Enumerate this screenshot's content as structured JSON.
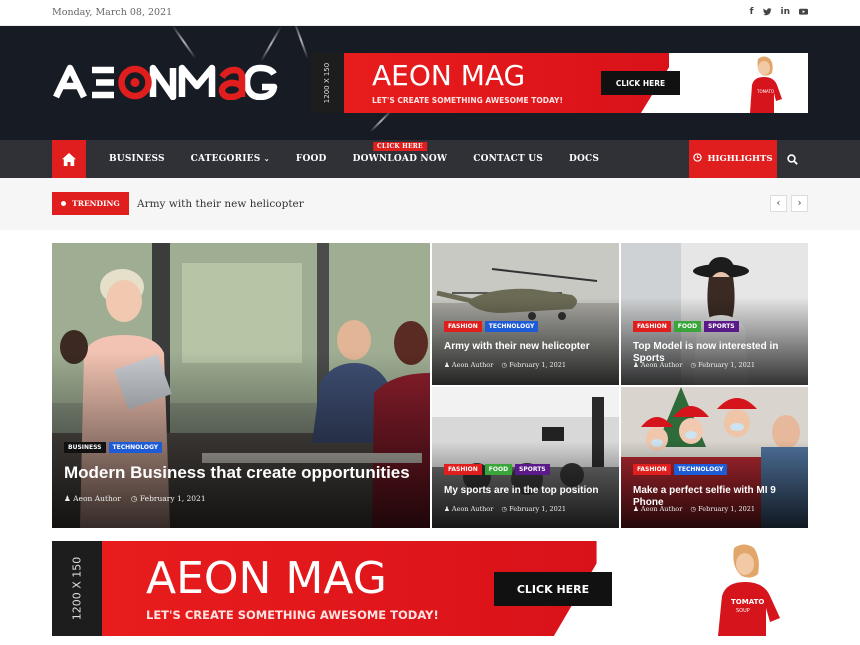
{
  "topbar": {
    "date": "Monday, March 08, 2021",
    "social": [
      "f",
      "t",
      "in",
      "yt"
    ]
  },
  "header": {
    "logo_text": "AEONMAG",
    "banner": {
      "size_label": "1200 X 150",
      "title": "AEON MAG",
      "tagline": "LET'S CREATE SOMETHING AWESOME TODAY!",
      "cta": "CLICK HERE"
    }
  },
  "nav": {
    "items": [
      "BUSINESS",
      "CATEGORIES",
      "FOOD",
      "DOWNLOAD NOW",
      "CONTACT US",
      "DOCS"
    ],
    "badge": "CLICK HERE",
    "highlights": "HIGHLIGHTS"
  },
  "trending": {
    "label": "TRENDING",
    "text": "Army with their new helicopter"
  },
  "posts": [
    {
      "cats": [
        "BUSINESS",
        "TECHNOLOGY"
      ],
      "title": "Modern Business that create opportunities",
      "author": "Aeon Author",
      "date": "February 1, 2021"
    },
    {
      "cats": [
        "FASHION",
        "TECHNOLOGY"
      ],
      "title": "Army with their new helicopter",
      "author": "Aeon Author",
      "date": "February 1, 2021"
    },
    {
      "cats": [
        "FASHION",
        "FOOD",
        "SPORTS"
      ],
      "title": "Top Model is now interested in Sports",
      "author": "Aeon Author",
      "date": "February 1, 2021"
    },
    {
      "cats": [
        "FASHION",
        "FOOD",
        "SPORTS"
      ],
      "title": "My sports are in the top position",
      "author": "Aeon Author",
      "date": "February 1, 2021"
    },
    {
      "cats": [
        "FASHION",
        "TECHNOLOGY"
      ],
      "title": "Make a perfect selfie with MI 9 Phone",
      "author": "Aeon Author",
      "date": "February 1, 2021"
    }
  ],
  "footer_banner": {
    "size_label": "1200 X 150",
    "title": "AEON MAG",
    "tagline": "LET'S CREATE SOMETHING AWESOME TODAY!",
    "cta": "CLICK HERE"
  },
  "colors": {
    "accent": "#e01e1e",
    "nav_bg": "#2f3137",
    "header_bg": "#171b24",
    "cat_business": "#111111",
    "cat_technology": "#1e5bd6",
    "cat_fashion": "#e01e1e",
    "cat_food": "#3aa53a",
    "cat_sports": "#5a1a8a"
  }
}
